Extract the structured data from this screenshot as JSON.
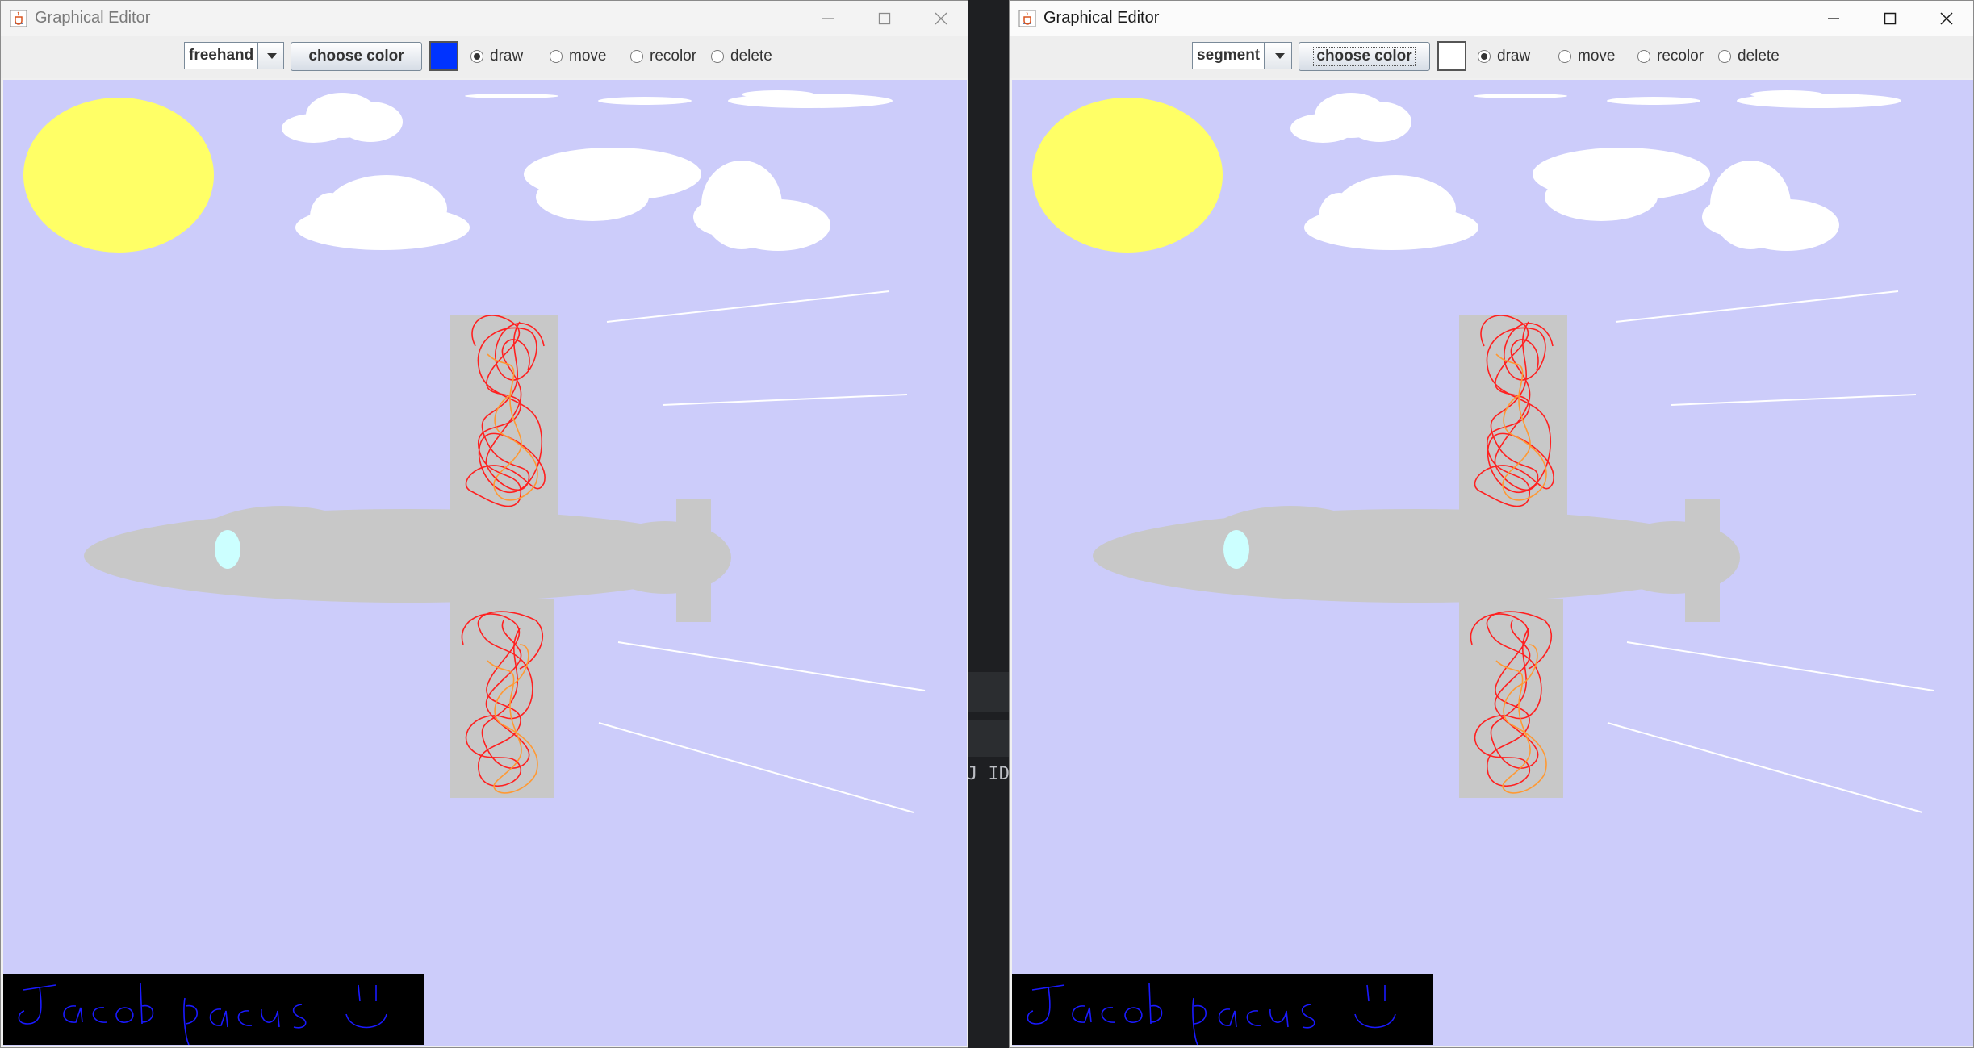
{
  "windows": [
    {
      "title": "Graphical Editor",
      "shape_select": "freehand",
      "choose_color_label": "choose color",
      "current_color": "#0033ff",
      "modes": [
        "draw",
        "move",
        "recolor",
        "delete"
      ],
      "selected_mode": "draw"
    },
    {
      "title": "Graphical Editor",
      "shape_select": "segment",
      "choose_color_label": "choose color",
      "current_color": "#ffffff",
      "modes": [
        "draw",
        "move",
        "recolor",
        "delete"
      ],
      "selected_mode": "draw"
    }
  ],
  "background_text": "J ID",
  "drawing": {
    "sky_color": "#ccccfa",
    "sun_color": "#ffff66",
    "plane_color": "#c8c8c8",
    "window_color": "#ccffff",
    "scribble_colors": [
      "#ff2020",
      "#ff9933"
    ],
    "signature_background": "#000000",
    "signature_ink": "#1a1aff"
  }
}
